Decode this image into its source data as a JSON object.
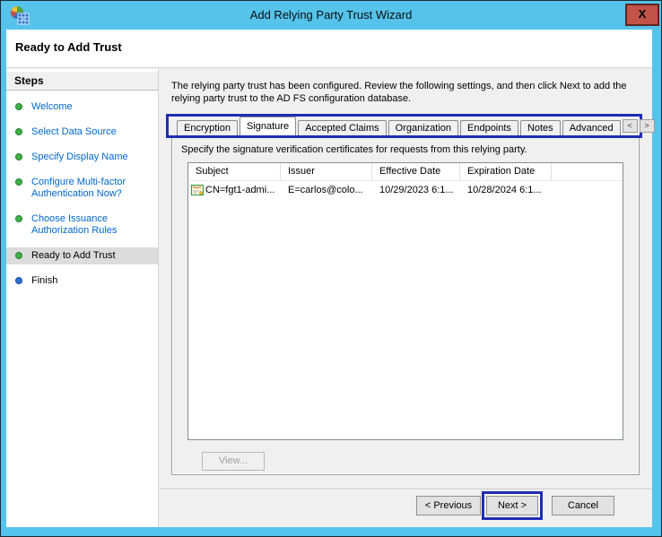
{
  "window": {
    "title": "Add Relying Party Trust Wizard",
    "close_glyph": "X"
  },
  "page_header": {
    "title": "Ready to Add Trust"
  },
  "sidebar": {
    "title": "Steps",
    "items": [
      {
        "label": "Welcome",
        "state": "done"
      },
      {
        "label": "Select Data Source",
        "state": "done"
      },
      {
        "label": "Specify Display Name",
        "state": "done"
      },
      {
        "label": "Configure Multi-factor Authentication Now?",
        "state": "done"
      },
      {
        "label": "Choose Issuance Authorization Rules",
        "state": "done"
      },
      {
        "label": "Ready to Add Trust",
        "state": "current"
      },
      {
        "label": "Finish",
        "state": "upcoming"
      }
    ]
  },
  "main": {
    "description": "The relying party trust has been configured. Review the following settings, and then click Next to add the relying party trust to the AD FS configuration database.",
    "tabs": [
      {
        "label": "Encryption",
        "active": false
      },
      {
        "label": "Signature",
        "active": true
      },
      {
        "label": "Accepted Claims",
        "active": false
      },
      {
        "label": "Organization",
        "active": false
      },
      {
        "label": "Endpoints",
        "active": false
      },
      {
        "label": "Notes",
        "active": false
      },
      {
        "label": "Advanced",
        "active": false
      }
    ],
    "tab_scroll_left": "<",
    "tab_scroll_right": ">",
    "signature_tab": {
      "instruction": "Specify the signature verification certificates for requests from this relying party.",
      "table": {
        "columns": [
          "Subject",
          "Issuer",
          "Effective Date",
          "Expiration Date"
        ],
        "rows": [
          {
            "subject": "CN=fgt1-admi...",
            "issuer": "E=carlos@colo...",
            "effective_date": "10/29/2023 6:1...",
            "expiration_date": "10/28/2024 6:1..."
          }
        ]
      },
      "view_button": "View..."
    },
    "footer_buttons": {
      "previous": "< Previous",
      "next": "Next >",
      "cancel": "Cancel"
    }
  },
  "colors": {
    "titlebar": "#55c3ea",
    "annotation_box": "#1f2db4",
    "step_link": "#0066cc",
    "step_done_bullet": "#3fb046",
    "step_upcoming_bullet": "#2e6fd2",
    "close_button": "#c25349"
  }
}
